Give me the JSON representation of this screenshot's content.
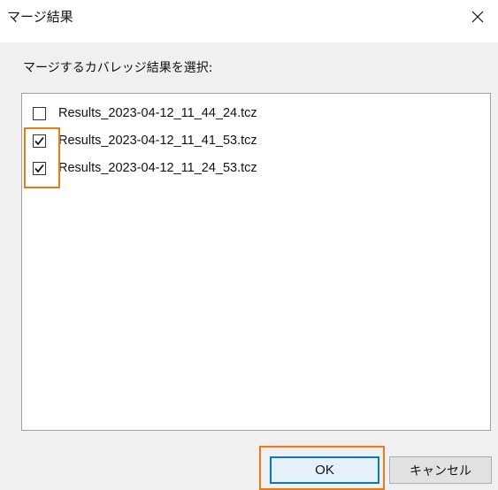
{
  "window": {
    "title": "マージ結果",
    "close_icon": "close-icon"
  },
  "prompt": "マージするカバレッジ結果を選択:",
  "files": [
    {
      "label": "Results_2023-04-12_11_44_24.tcz",
      "checked": false
    },
    {
      "label": "Results_2023-04-12_11_41_53.tcz",
      "checked": true
    },
    {
      "label": "Results_2023-04-12_11_24_53.tcz",
      "checked": true
    }
  ],
  "buttons": {
    "ok_label": "OK",
    "cancel_label": "キャンセル"
  },
  "colors": {
    "highlight": "#ec7a16",
    "dialog_bg": "#f0f0f0",
    "button_bg": "#e1e1e1"
  }
}
